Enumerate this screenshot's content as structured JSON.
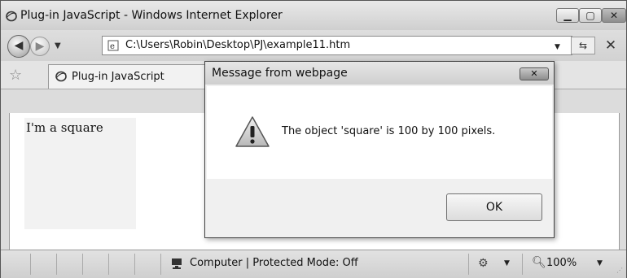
{
  "window": {
    "title": "Plug-in JavaScript - Windows Internet Explorer"
  },
  "address_bar": {
    "url": "C:\\Users\\Robin\\Desktop\\PJ\\example11.htm"
  },
  "tabs": [
    {
      "label": "Plug-in JavaScript"
    }
  ],
  "page": {
    "square_text": "I'm a square"
  },
  "status_bar": {
    "zone": "Computer | Protected Mode: Off",
    "zoom": "100%"
  },
  "dialog": {
    "title": "Message from webpage",
    "message": "The object 'square' is 100 by 100 pixels.",
    "ok_label": "OK"
  },
  "icons": {
    "title": "ie-icon",
    "back": "back-arrow-icon",
    "forward": "forward-arrow-icon",
    "page": "ie-page-icon",
    "favorites": "star-icon",
    "warning": "warning-icon",
    "zone": "computer-icon",
    "zoom": "magnifier-icon"
  },
  "colors": {
    "chrome": "#dcdcdc",
    "dialog_body": "#ffffff",
    "square_bg": "#f2f2f2"
  }
}
